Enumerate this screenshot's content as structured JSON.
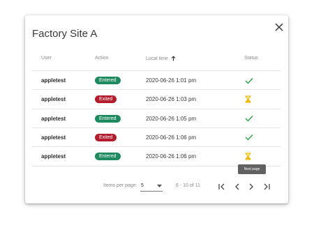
{
  "dialog": {
    "title": "Factory Site A"
  },
  "table": {
    "columns": {
      "user": "User",
      "action": "Action",
      "time": "Local time",
      "status": "Status"
    },
    "rows": [
      {
        "user": "appletest",
        "action": "Entered",
        "time": "2020-06-26 1:01 pm",
        "status": "check"
      },
      {
        "user": "appletest",
        "action": "Exited",
        "time": "2020-06-26 1:03 pm",
        "status": "hourglass"
      },
      {
        "user": "appletest",
        "action": "Entered",
        "time": "2020-06-26 1:05 pm",
        "status": "check"
      },
      {
        "user": "appletest",
        "action": "Exited",
        "time": "2020-06-26 1:06 pm",
        "status": "check"
      },
      {
        "user": "appletest",
        "action": "Entered",
        "time": "2020-06-26 1:06 pm",
        "status": "hourglass"
      }
    ]
  },
  "colors": {
    "entered": "#1d8a5f",
    "exited": "#b31c2c",
    "check": "#2e9e47",
    "hourglass": "#f2b705"
  },
  "paginator": {
    "items_per_page_label": "Items per page:",
    "items_per_page_value": "5",
    "range_label": "6 - 10 of 11",
    "tooltip": "Next page"
  },
  "icons": {
    "close": "close-icon",
    "sort": "arrow-up-icon",
    "first": "first-page-icon",
    "prev": "chevron-left-icon",
    "next": "chevron-right-icon",
    "last": "last-page-icon"
  }
}
